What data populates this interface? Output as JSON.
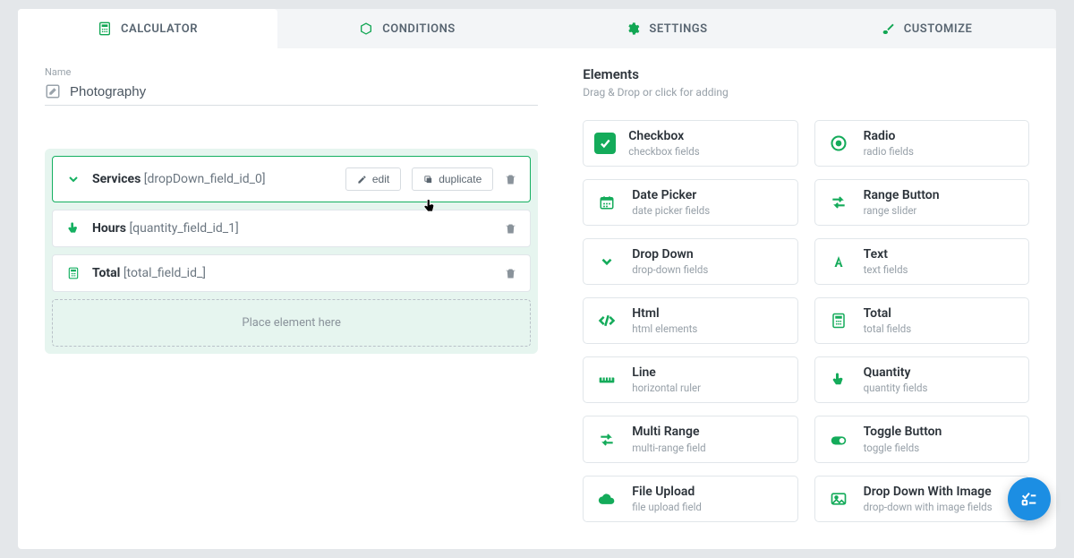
{
  "tabs": [
    {
      "label": "CALCULATOR"
    },
    {
      "label": "CONDITIONS"
    },
    {
      "label": "SETTINGS"
    },
    {
      "label": "CUSTOMIZE"
    }
  ],
  "name_section": {
    "label": "Name",
    "value": "Photography"
  },
  "fields": [
    {
      "title": "Services",
      "slug": "[dropDown_field_id_0]",
      "selected": true
    },
    {
      "title": "Hours",
      "slug": "[quantity_field_id_1]",
      "selected": false
    },
    {
      "title": "Total",
      "slug": "[total_field_id_]",
      "selected": false
    }
  ],
  "field_actions": {
    "edit": "edit",
    "duplicate": "duplicate"
  },
  "placeholder_text": "Place element here",
  "elements_header": {
    "title": "Elements",
    "subtitle": "Drag & Drop or click for adding"
  },
  "palette": [
    {
      "name": "Checkbox",
      "desc": "checkbox fields"
    },
    {
      "name": "Radio",
      "desc": "radio fields"
    },
    {
      "name": "Date Picker",
      "desc": "date picker fields"
    },
    {
      "name": "Range Button",
      "desc": "range slider"
    },
    {
      "name": "Drop Down",
      "desc": "drop-down fields"
    },
    {
      "name": "Text",
      "desc": "text fields"
    },
    {
      "name": "Html",
      "desc": "html elements"
    },
    {
      "name": "Total",
      "desc": "total fields"
    },
    {
      "name": "Line",
      "desc": "horizontal ruler"
    },
    {
      "name": "Quantity",
      "desc": "quantity fields"
    },
    {
      "name": "Multi Range",
      "desc": "multi-range field"
    },
    {
      "name": "Toggle Button",
      "desc": "toggle fields"
    },
    {
      "name": "File Upload",
      "desc": "file upload field"
    },
    {
      "name": "Drop Down With Image",
      "desc": "drop-down with image fields"
    }
  ]
}
